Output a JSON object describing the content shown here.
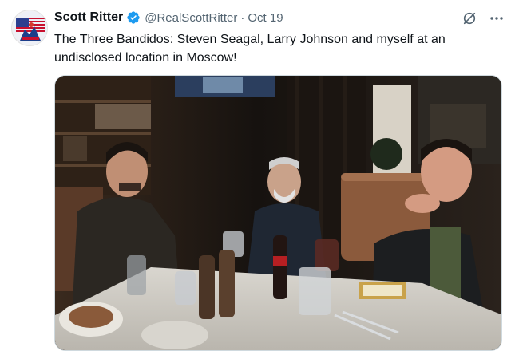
{
  "post": {
    "author_name": "Scott Ritter",
    "handle": "@RealScottRitter",
    "separator": "·",
    "timestamp": "Oct 19",
    "text": "The Three Bandidos: Steven Seagal, Larry Johnson and myself at an undisclosed location in Moscow!",
    "verified": true
  },
  "icons": {
    "verified": "verified-badge-icon",
    "grok": "grok-icon",
    "more": "more-options-icon"
  },
  "colors": {
    "verified_blue": "#1d9bf0",
    "secondary_text": "#536471",
    "primary_text": "#0f1419"
  }
}
